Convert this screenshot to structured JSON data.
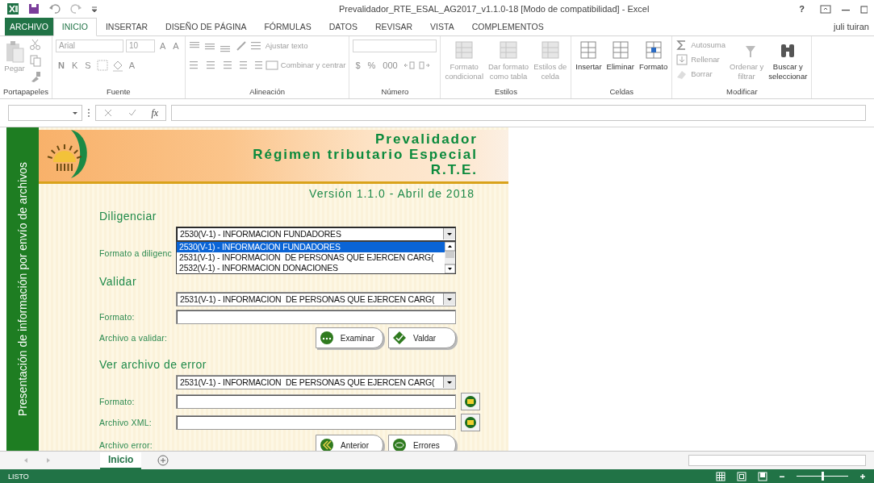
{
  "title_bar": {
    "title": "Prevalidador_RTE_ESAL_AG2017_v1.1.0-18  [Modo de compatibilidad] - Excel",
    "help": "?"
  },
  "tabs": [
    {
      "label": "ARCHIVO",
      "kind": "file",
      "selected": false
    },
    {
      "label": "INICIO",
      "kind": "tab",
      "selected": true
    },
    {
      "label": "INSERTAR",
      "kind": "tab",
      "selected": false
    },
    {
      "label": "DISEÑO DE PÁGINA",
      "kind": "tab",
      "selected": false
    },
    {
      "label": "FÓRMULAS",
      "kind": "tab",
      "selected": false
    },
    {
      "label": "DATOS",
      "kind": "tab",
      "selected": false
    },
    {
      "label": "REVISAR",
      "kind": "tab",
      "selected": false
    },
    {
      "label": "VISTA",
      "kind": "tab",
      "selected": false
    },
    {
      "label": "COMPLEMENTOS",
      "kind": "tab",
      "selected": false
    }
  ],
  "user": "juli tuiran",
  "ribbon": {
    "groups": [
      {
        "label": "Portapapeles",
        "buttons": [
          {
            "label": "Pegar",
            "disabled": true
          }
        ]
      },
      {
        "label": "Fuente",
        "combos": [
          "Arial",
          "10"
        ],
        "glyphs": [
          {
            "label": "A",
            "disabled": true
          },
          {
            "label": "A",
            "disabled": true
          },
          {
            "label": "N",
            "disabled": true
          },
          {
            "label": "K",
            "disabled": true
          },
          {
            "label": "S",
            "disabled": true
          },
          {
            "label": "A",
            "disabled": true
          }
        ]
      },
      {
        "label": "Alineación",
        "buttons": [
          {
            "label": "Ajustar texto",
            "disabled": true
          },
          {
            "label": "Combinar y centrar",
            "disabled": true
          }
        ]
      },
      {
        "label": "Número",
        "glyphs": [
          {
            "label": "$",
            "disabled": true
          },
          {
            "label": "%",
            "disabled": true
          },
          {
            "label": "000",
            "disabled": true
          }
        ]
      },
      {
        "label": "Estilos",
        "buttons": [
          {
            "label": "Formato\ncondicional",
            "disabled": true
          },
          {
            "label": "Dar formato\ncomo tabla",
            "disabled": true
          },
          {
            "label": "Estilos de\ncelda",
            "disabled": true
          }
        ]
      },
      {
        "label": "Celdas",
        "buttons": [
          {
            "label": "Insertar",
            "disabled": false
          },
          {
            "label": "Eliminar",
            "disabled": false
          },
          {
            "label": "Formato",
            "disabled": false
          }
        ]
      },
      {
        "label": "Modificar",
        "buttons": [
          {
            "label": "Autosuma",
            "disabled": true
          },
          {
            "label": "Rellenar",
            "disabled": true
          },
          {
            "label": "Borrar",
            "disabled": true
          },
          {
            "label": "Ordenar y\nfiltrar",
            "disabled": true
          },
          {
            "label": "Buscar y\nseleccionar",
            "disabled": false
          }
        ]
      }
    ]
  },
  "formula_bar": {
    "fx": "fx"
  },
  "sheet": {
    "side_label": "Presentación de información por envío de archivos",
    "header_lines": [
      "Prevalidador",
      "Régimen tributario Especial",
      "R.T.E."
    ],
    "version": "Versión 1.1.0 - Abril de 2018",
    "sections": [
      {
        "heading": "Diligenciar",
        "combo": {
          "value": "2530(V-1) - INFORMACION FUNDADORES",
          "expanded": true,
          "options": [
            {
              "text": "2530(V-1) - INFORMACION FUNDADORES",
              "selected": true
            },
            {
              "text": "2531(V-1) - INFORMACION  DE PERSONAS QUE EJERCEN CARG(",
              "selected": false
            },
            {
              "text": "2532(V-1) - INFORMACION DONACIONES",
              "selected": false
            }
          ]
        },
        "rows": [
          {
            "kind": "label",
            "label": "Formato a diligenc"
          }
        ]
      },
      {
        "heading": "Validar",
        "combo": {
          "value": "2531(V-1) - INFORMACION  DE PERSONAS QUE EJERCEN CARG(",
          "expanded": false
        },
        "rows": [
          {
            "kind": "field",
            "label": "Formato:",
            "browse": false
          },
          {
            "kind": "buttons",
            "label": "Archivo a validar:",
            "buttons": [
              "Examinar",
              "Valdar"
            ]
          }
        ]
      },
      {
        "heading": "Ver archivo de error",
        "combo": {
          "value": "2531(V-1) - INFORMACION  DE PERSONAS QUE EJERCEN CARG(",
          "expanded": false
        },
        "rows": [
          {
            "kind": "field",
            "label": "Formato:",
            "browse": true
          },
          {
            "kind": "field",
            "label": "Archivo XML:",
            "browse": true
          },
          {
            "kind": "buttons",
            "label": "Archivo error:",
            "buttons": [
              "Anterior",
              "Errores"
            ]
          }
        ]
      }
    ]
  },
  "sheet_tabs": [
    {
      "label": "Inicio",
      "selected": true
    }
  ],
  "status_bar": {
    "status": "LISTO",
    "zoom": {
      "level": 0.5
    }
  }
}
